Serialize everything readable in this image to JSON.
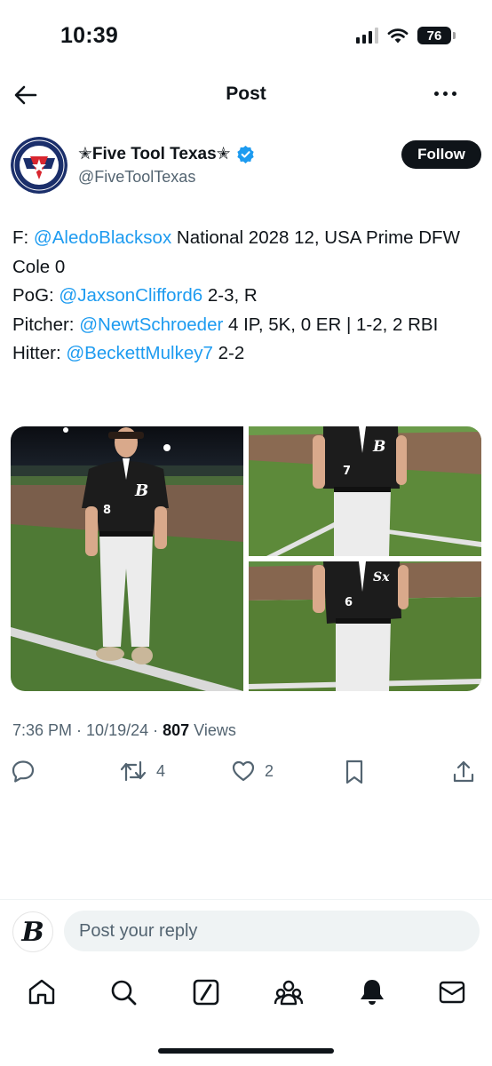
{
  "status_bar": {
    "time": "10:39",
    "battery": "76"
  },
  "header": {
    "title": "Post"
  },
  "author": {
    "name": "✭Five Tool Texas✭",
    "handle": "@FiveToolTexas",
    "verified_color": "#1d9bf0",
    "logo_text": "FIVE TOOL TEXAS"
  },
  "follow_label": "Follow",
  "post": {
    "line1_prefix": "F: ",
    "line1_mention": "@AledoBlacksox",
    "line1_rest": " National 2028 12, USA Prime DFW Cole 0",
    "line2_prefix": "PoG: ",
    "line2_mention": "@JaxsonClifford6",
    "line2_rest": " 2-3, R",
    "line3_prefix": "Pitcher: ",
    "line3_mention": "@NewtSchroeder",
    "line3_rest": " 4 IP, 5K, 0 ER | 1-2, 2 RBI",
    "line4_prefix": "Hitter: ",
    "line4_mention": "@BeckettMulkey7",
    "line4_rest": " 2-2"
  },
  "media": {
    "photos": [
      {
        "description": "player-number-8",
        "jersey_number": "8",
        "jersey_letter": "B"
      },
      {
        "description": "player-number-7",
        "jersey_number": "7",
        "jersey_letter": "B"
      },
      {
        "description": "player-number-6",
        "jersey_number": "6",
        "jersey_letter": "Sx"
      }
    ]
  },
  "meta": {
    "time": "7:36 PM",
    "separator": " · ",
    "date": "10/19/24",
    "views_count": "807",
    "views_label": " Views"
  },
  "actions": {
    "reposts": "4",
    "likes": "2"
  },
  "reply": {
    "placeholder": "Post your reply",
    "avatar_letter": "B"
  },
  "colors": {
    "accent": "#1d9bf0",
    "text": "#0f1419",
    "secondary": "#536471"
  }
}
